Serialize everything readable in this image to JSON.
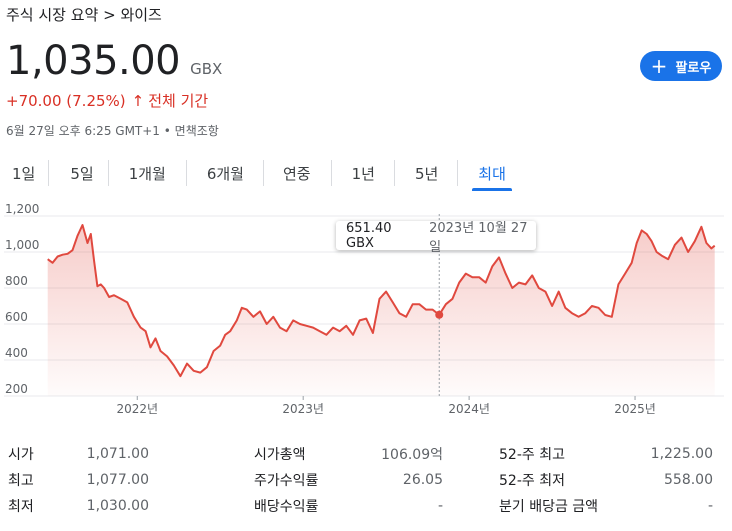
{
  "breadcrumb": "주식 시장 요약 > 와이즈",
  "quote": {
    "price": "1,035.00",
    "currency": "GBX",
    "change": "+70.00 (7.25%)",
    "change_arrow": "↑",
    "period": "전체 기간",
    "meta": "6월 27일 오후 6:25 GMT+1 • 면책조항"
  },
  "follow_button": {
    "icon": "plus-icon",
    "label": "팔로우"
  },
  "tabs": [
    {
      "label": "1일"
    },
    {
      "label": "5일"
    },
    {
      "label": "1개월"
    },
    {
      "label": "6개월"
    },
    {
      "label": "연중"
    },
    {
      "label": "1년"
    },
    {
      "label": "5년"
    },
    {
      "label": "최대",
      "active": true
    }
  ],
  "tooltip": {
    "value": "651.40 GBX",
    "date": "2023년 10월 27일"
  },
  "colors": {
    "accent": "#1a73e8",
    "negative_line": "#e0493f",
    "change_text": "#d93025"
  },
  "chart_data": {
    "type": "area",
    "y_ticks": [
      "1,200",
      "1,000",
      "800",
      "600",
      "400",
      "200"
    ],
    "x_ticks": [
      "2022년",
      "2023년",
      "2024년",
      "2025년"
    ],
    "ylim": [
      200,
      1200
    ],
    "xlim": [
      2021.45,
      2025.5
    ],
    "grid": true,
    "x": [
      2021.46,
      2021.49,
      2021.52,
      2021.55,
      2021.58,
      2021.61,
      2021.64,
      2021.67,
      2021.7,
      2021.72,
      2021.74,
      2021.76,
      2021.78,
      2021.8,
      2021.83,
      2021.86,
      2021.9,
      2021.94,
      2021.98,
      2022.02,
      2022.05,
      2022.08,
      2022.11,
      2022.14,
      2022.18,
      2022.22,
      2022.26,
      2022.3,
      2022.34,
      2022.38,
      2022.42,
      2022.46,
      2022.5,
      2022.53,
      2022.56,
      2022.6,
      2022.63,
      2022.66,
      2022.7,
      2022.74,
      2022.78,
      2022.82,
      2022.86,
      2022.9,
      2022.94,
      2022.98,
      2023.02,
      2023.06,
      2023.1,
      2023.14,
      2023.18,
      2023.22,
      2023.26,
      2023.3,
      2023.34,
      2023.38,
      2023.42,
      2023.46,
      2023.5,
      2023.54,
      2023.58,
      2023.62,
      2023.66,
      2023.7,
      2023.74,
      2023.78,
      2023.82,
      2023.86,
      2023.9,
      2023.94,
      2023.98,
      2024.02,
      2024.06,
      2024.1,
      2024.14,
      2024.18,
      2024.22,
      2024.26,
      2024.3,
      2024.34,
      2024.38,
      2024.42,
      2024.46,
      2024.5,
      2024.54,
      2024.58,
      2024.62,
      2024.66,
      2024.7,
      2024.74,
      2024.78,
      2024.82,
      2024.86,
      2024.9,
      2024.94,
      2024.98,
      2025.01,
      2025.04,
      2025.07,
      2025.1,
      2025.13,
      2025.16,
      2025.2,
      2025.24,
      2025.28,
      2025.32,
      2025.36,
      2025.4,
      2025.43,
      2025.46,
      2025.48
    ],
    "values": [
      960,
      940,
      975,
      985,
      990,
      1010,
      1090,
      1150,
      1050,
      1100,
      950,
      810,
      820,
      800,
      750,
      760,
      740,
      720,
      640,
      580,
      560,
      470,
      520,
      450,
      420,
      370,
      310,
      380,
      340,
      330,
      360,
      450,
      480,
      540,
      560,
      620,
      690,
      680,
      640,
      670,
      600,
      640,
      580,
      560,
      620,
      600,
      590,
      580,
      560,
      540,
      580,
      560,
      590,
      540,
      620,
      630,
      550,
      740,
      780,
      720,
      660,
      640,
      710,
      710,
      680,
      680,
      651,
      710,
      740,
      830,
      880,
      860,
      860,
      830,
      920,
      970,
      880,
      800,
      830,
      820,
      870,
      800,
      780,
      700,
      780,
      690,
      660,
      640,
      660,
      700,
      690,
      650,
      640,
      820,
      880,
      940,
      1050,
      1120,
      1100,
      1060,
      1000,
      980,
      960,
      1040,
      1080,
      1000,
      1060,
      1140,
      1050,
      1020,
      1035
    ],
    "series": [
      {
        "values": []
      }
    ]
  },
  "stats": [
    {
      "label": "시가",
      "value": "1,071.00"
    },
    {
      "label": "최고",
      "value": "1,077.00"
    },
    {
      "label": "최저",
      "value": "1,030.00"
    },
    {
      "label": "시가총액",
      "value": "106.09억"
    },
    {
      "label": "주가수익률",
      "value": "26.05"
    },
    {
      "label": "배당수익률",
      "value": "-"
    },
    {
      "label": "52-주 최고",
      "value": "1,225.00"
    },
    {
      "label": "52-주 최저",
      "value": "558.00"
    },
    {
      "label": "분기 배당금 금액",
      "value": "-"
    }
  ]
}
